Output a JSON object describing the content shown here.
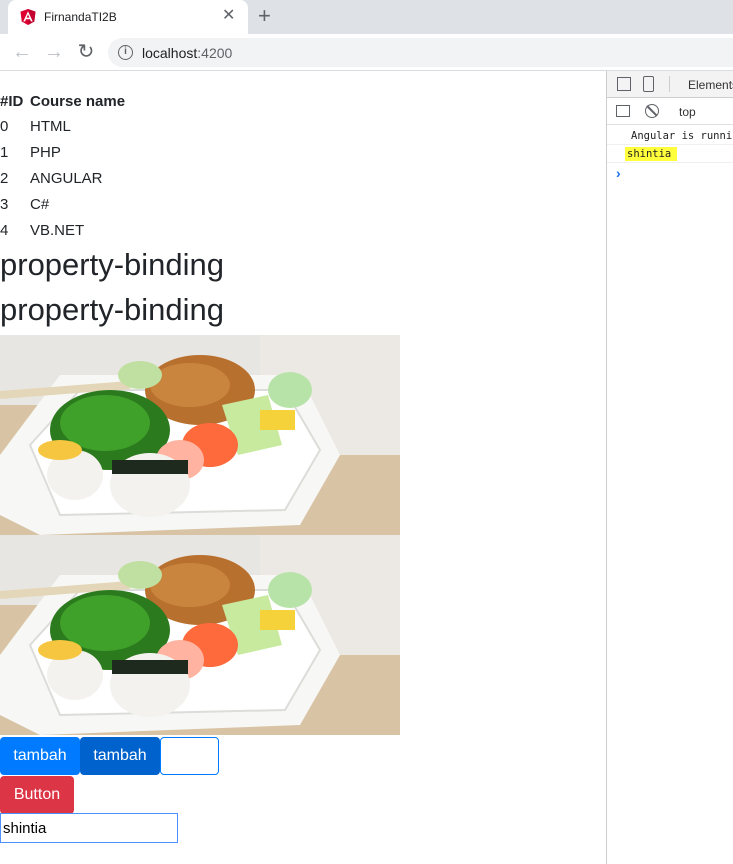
{
  "browser": {
    "tab_title": "FirnandaTI2B",
    "close_glyph": "✕",
    "newtab_glyph": "+",
    "url_host": "localhost",
    "url_port": ":4200"
  },
  "page": {
    "table": {
      "headers": [
        "#ID",
        "Course name"
      ],
      "rows": [
        [
          "0",
          "HTML"
        ],
        [
          "1",
          "PHP"
        ],
        [
          "2",
          "ANGULAR"
        ],
        [
          "3",
          "C#"
        ],
        [
          "4",
          "VB.NET"
        ]
      ]
    },
    "heading_1": "property-binding",
    "heading_2": "property-binding",
    "buttons": {
      "tambah_1": "tambah",
      "tambah_2": "tambah",
      "button_3": "",
      "danger": "Button"
    },
    "input_value": "shintia"
  },
  "devtools": {
    "tab_elements": "Elements",
    "context": "top",
    "console": [
      "Angular is running in development mode.",
      "shintia"
    ],
    "prompt": "›"
  },
  "colors": {
    "primary": "#007bff",
    "primary_active": "#0062cc",
    "danger": "#dc3545",
    "highlight": "#ffff3c"
  },
  "icons": [
    "angular-favicon",
    "back-arrow-icon",
    "forward-arrow-icon",
    "reload-icon",
    "info-icon",
    "inspect-icon",
    "device-toolbar-icon",
    "sidebar-icon",
    "clear-console-icon"
  ]
}
